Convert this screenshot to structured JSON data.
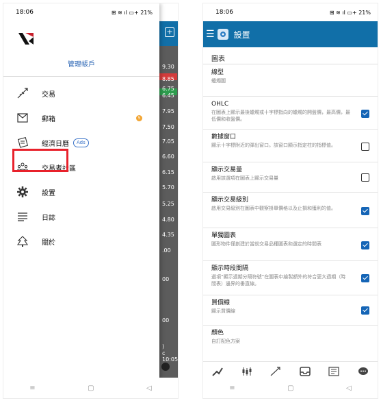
{
  "left": {
    "status": {
      "time": "18:06",
      "indicators": "⊞ ≋ ıl ▭+ 21%"
    },
    "account_label": "管理帳戶",
    "menu": [
      {
        "label": "交易",
        "icon": "trade-icon"
      },
      {
        "label": "郵箱",
        "icon": "mail-icon",
        "badge": "5"
      },
      {
        "label": "經濟日曆",
        "icon": "calendar-icon",
        "tag": "Ads"
      },
      {
        "label": "交易者社區",
        "icon": "community-icon"
      },
      {
        "label": "設置",
        "icon": "gear-icon"
      },
      {
        "label": "日誌",
        "icon": "journal-icon"
      },
      {
        "label": "關於",
        "icon": "about-icon"
      }
    ],
    "behind_values": [
      "9.30",
      "8.85",
      "6.75",
      "6.45",
      "7.95",
      "7.50",
      "7.05",
      "6.60",
      "6.15",
      "5.70",
      "5.25",
      "4.80",
      "4.35",
      ".00",
      "00",
      "00",
      ")",
      "c 10:05"
    ],
    "nav": [
      "≡",
      "▢",
      "◁"
    ]
  },
  "right": {
    "status": {
      "time": "18:06",
      "indicators": "⊞ ≋ ıl ▭+ 21%"
    },
    "title": "設置",
    "section": "圖表",
    "rows": [
      {
        "title": "線型",
        "desc": "蠟燭圖"
      },
      {
        "title": "OHLC",
        "desc": "在圖表上顯示最後蠟燭或十字標指向的蠟燭的開盤價，最高價，最低價和收盤價。",
        "checked": true
      },
      {
        "title": "數據窗口",
        "desc": "顯示十字標附近的彈出窗口。該窗口顯示指定柱的指標值。",
        "checked": false
      },
      {
        "title": "顯示交易量",
        "desc": "啟用該選項在圖表上顯示交易量",
        "checked": false
      },
      {
        "title": "顯示交易級別",
        "desc": "啟用交易級別在圖表中觀察掛單價格以及止損和獲利的值。",
        "checked": true
      },
      {
        "title": "單獨圖表",
        "desc": "圖形物件僅創建於當前交易品種圖表和選定的時間表",
        "checked": true
      },
      {
        "title": "顯示時段間隔",
        "desc": "選項“顯示週期分隔符號”在圖表中繪製額外的符合更大週期（時間表）邊界的垂直線。",
        "checked": true
      },
      {
        "title": "買價線",
        "desc": "顯示買價線",
        "checked": true
      },
      {
        "title": "顏色",
        "desc": "自訂配色方案"
      }
    ],
    "bottom": [
      "chart-tool-icon",
      "indicators-icon",
      "trade-icon",
      "inbox-icon",
      "news-icon",
      "chat-icon"
    ],
    "nav": [
      "≡",
      "▢",
      "◁"
    ]
  }
}
